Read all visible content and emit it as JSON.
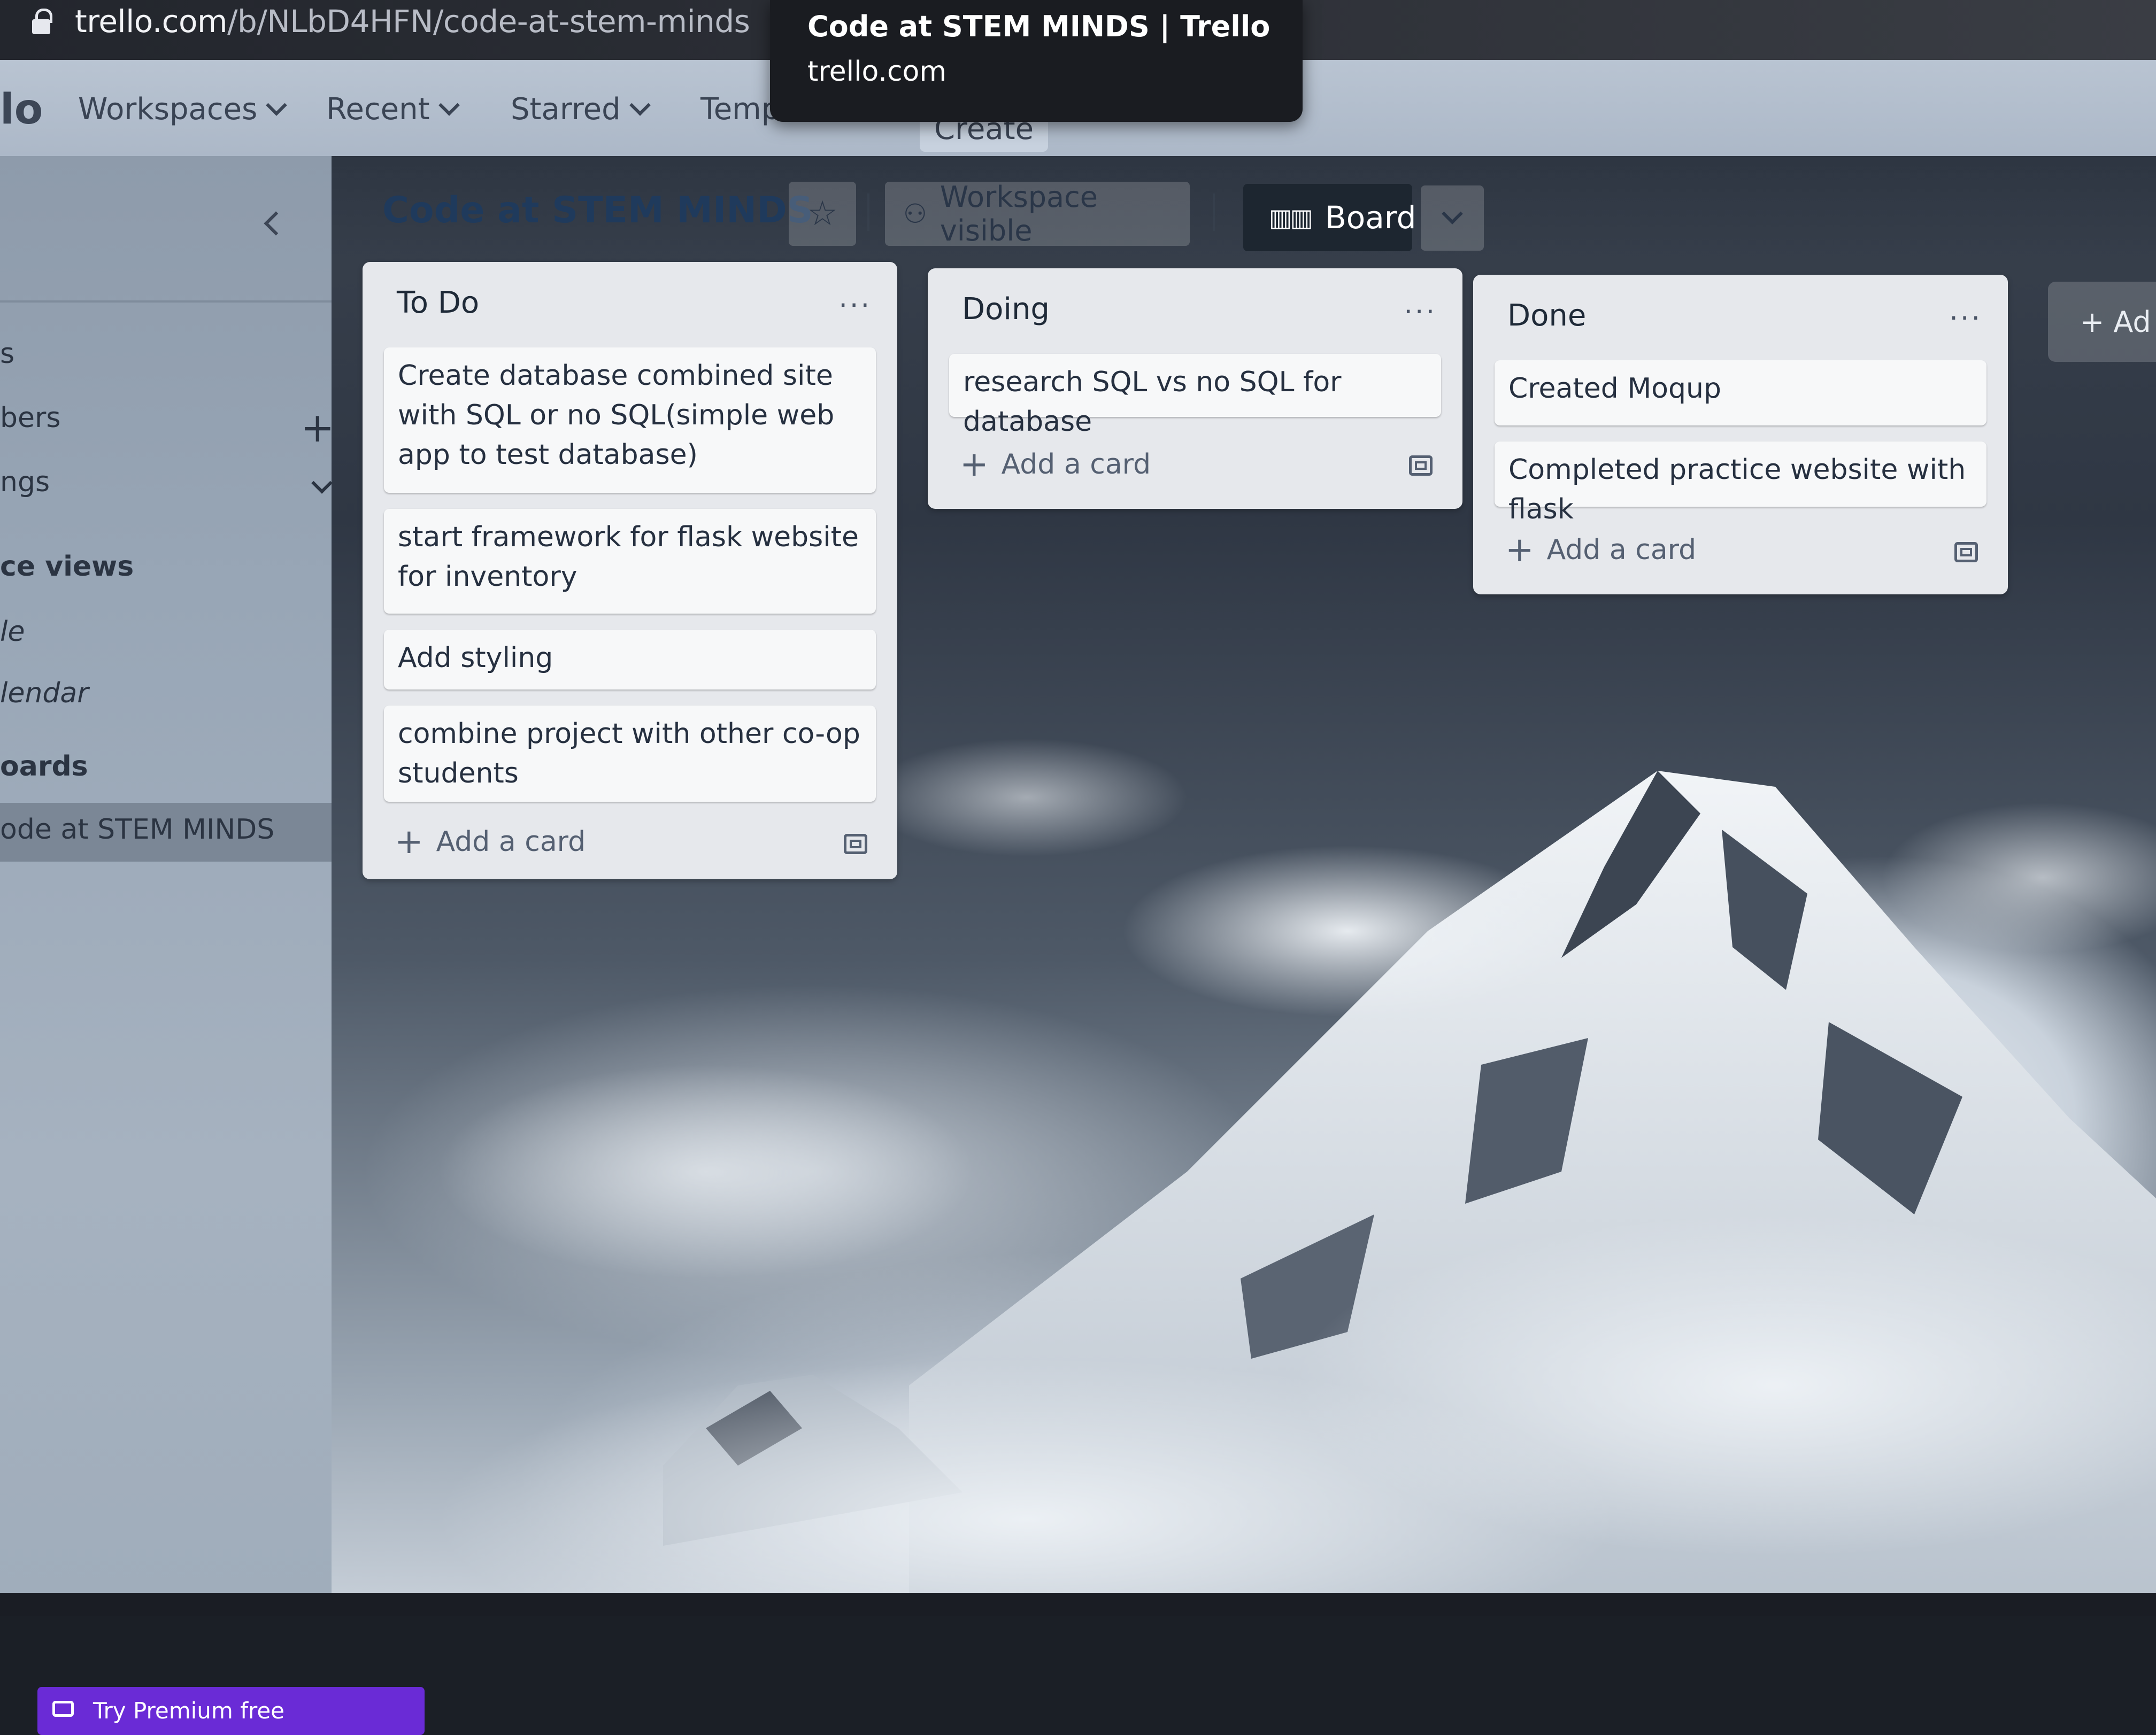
{
  "browser": {
    "url_host": "trello.com",
    "url_path": "/b/NLbD4HFN/code-at-stem-minds",
    "tooltip_title": "Code at STEM MINDS | Trello",
    "tooltip_subtitle": "trello.com"
  },
  "topnav": {
    "logo": "lo",
    "items": [
      {
        "label": "Workspaces"
      },
      {
        "label": "Recent"
      },
      {
        "label": "Starred"
      },
      {
        "label": "Templates"
      }
    ],
    "create_label": "Create"
  },
  "sidebar": {
    "items": [
      "s",
      "bers",
      "ngs",
      "ce views",
      "le",
      "lendar",
      "oards",
      "ode at STEM MINDS"
    ],
    "premium_label": "Try Premium free"
  },
  "board": {
    "title": "Code at STEM MINDS",
    "visibility_label": "Workspace visible",
    "view_label": "Board",
    "add_list_label": "+ Ad",
    "lists": [
      {
        "title": "To Do",
        "cards": [
          "Create database combined site with SQL or no SQL(simple web app to test database)",
          "start framework for flask website for inventory",
          "Add styling",
          "combine project with other co-op students"
        ],
        "add_label": "Add a card"
      },
      {
        "title": "Doing",
        "cards": [
          "research SQL vs no SQL for database"
        ],
        "add_label": "Add a card"
      },
      {
        "title": "Done",
        "cards": [
          "Created Moqup",
          "Completed practice website with flask"
        ],
        "add_label": "Add a card"
      }
    ]
  },
  "colors": {
    "premium": "#6a2bd6",
    "board_button": "#1d2630",
    "title": "#1f3a5c"
  }
}
